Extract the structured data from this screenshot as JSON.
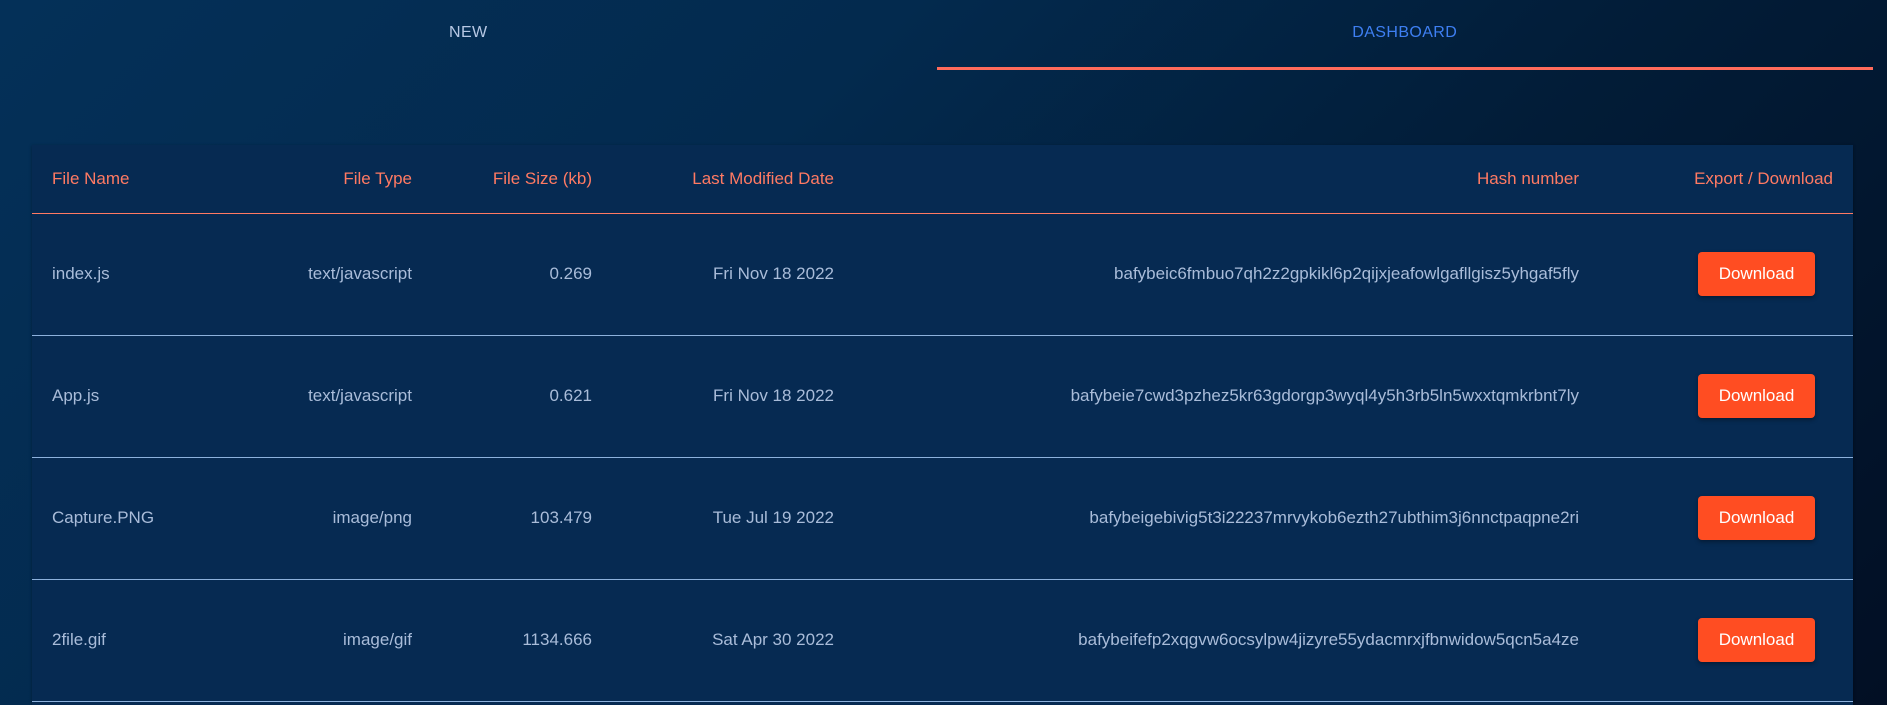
{
  "tabs": {
    "new_label": "NEW",
    "dashboard_label": "DASHBOARD",
    "active": "DASHBOARD"
  },
  "colors": {
    "accent": "#ff6b5b",
    "button": "#ff4d22",
    "active_tab_text": "#3e7ff2"
  },
  "table": {
    "headers": {
      "file_name": "File Name",
      "file_type": "File Type",
      "file_size": "File Size (kb)",
      "last_modified": "Last Modified Date",
      "hash": "Hash number",
      "export": "Export / Download"
    },
    "rows": [
      {
        "name": "index.js",
        "type": "text/javascript",
        "size": "0.269",
        "date": "Fri Nov 18 2022",
        "hash": "bafybeic6fmbuo7qh2z2gpkikl6p2qijxjeafowlgafllgisz5yhgaf5fly",
        "action": "Download"
      },
      {
        "name": "App.js",
        "type": "text/javascript",
        "size": "0.621",
        "date": "Fri Nov 18 2022",
        "hash": "bafybeie7cwd3pzhez5kr63gdorgp3wyql4y5h3rb5ln5wxxtqmkrbnt7ly",
        "action": "Download"
      },
      {
        "name": "Capture.PNG",
        "type": "image/png",
        "size": "103.479",
        "date": "Tue Jul 19 2022",
        "hash": "bafybeigebivig5t3i22237mrvykob6ezth27ubthim3j6nnctpaqpne2ri",
        "action": "Download"
      },
      {
        "name": "2file.gif",
        "type": "image/gif",
        "size": "1134.666",
        "date": "Sat Apr 30 2022",
        "hash": "bafybeifefp2xqgvw6ocsylpw4jizyre55ydacmrxjfbnwidow5qcn5a4ze",
        "action": "Download"
      }
    ]
  }
}
